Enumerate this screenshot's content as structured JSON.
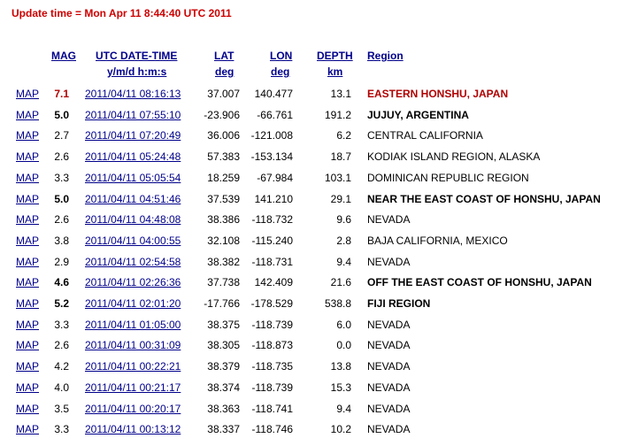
{
  "update_time": "Update time = Mon Apr 11 8:44:40 UTC 2011",
  "headers": {
    "mag": "MAG",
    "datetime": "UTC DATE-TIME",
    "datetime_sub": "y/m/d h:m:s",
    "lat": "LAT",
    "lat_sub": "deg",
    "lon": "LON",
    "lon_sub": "deg",
    "depth": "DEPTH",
    "depth_sub": "km",
    "region": "Region"
  },
  "rows": [
    {
      "map": "MAP",
      "mag": "7.1",
      "datetime": "2011/04/11 08:16:13",
      "lat": "37.007",
      "lon": "140.477",
      "depth": "13.1",
      "region": "EASTERN HONSHU, JAPAN",
      "style": "red"
    },
    {
      "map": "MAP",
      "mag": "5.0",
      "datetime": "2011/04/11 07:55:10",
      "lat": "-23.906",
      "lon": "-66.761",
      "depth": "191.2",
      "region": "JUJUY, ARGENTINA",
      "style": "big"
    },
    {
      "map": "MAP",
      "mag": "2.7",
      "datetime": "2011/04/11 07:20:49",
      "lat": "36.006",
      "lon": "-121.008",
      "depth": "6.2",
      "region": "CENTRAL CALIFORNIA",
      "style": "normal"
    },
    {
      "map": "MAP",
      "mag": "2.6",
      "datetime": "2011/04/11 05:24:48",
      "lat": "57.383",
      "lon": "-153.134",
      "depth": "18.7",
      "region": "KODIAK ISLAND REGION, ALASKA",
      "style": "normal"
    },
    {
      "map": "MAP",
      "mag": "3.3",
      "datetime": "2011/04/11 05:05:54",
      "lat": "18.259",
      "lon": "-67.984",
      "depth": "103.1",
      "region": "DOMINICAN REPUBLIC REGION",
      "style": "normal"
    },
    {
      "map": "MAP",
      "mag": "5.0",
      "datetime": "2011/04/11 04:51:46",
      "lat": "37.539",
      "lon": "141.210",
      "depth": "29.1",
      "region": "NEAR THE EAST COAST OF HONSHU, JAPAN",
      "style": "big"
    },
    {
      "map": "MAP",
      "mag": "2.6",
      "datetime": "2011/04/11 04:48:08",
      "lat": "38.386",
      "lon": "-118.732",
      "depth": "9.6",
      "region": "NEVADA",
      "style": "normal"
    },
    {
      "map": "MAP",
      "mag": "3.8",
      "datetime": "2011/04/11 04:00:55",
      "lat": "32.108",
      "lon": "-115.240",
      "depth": "2.8",
      "region": "BAJA CALIFORNIA, MEXICO",
      "style": "normal"
    },
    {
      "map": "MAP",
      "mag": "2.9",
      "datetime": "2011/04/11 02:54:58",
      "lat": "38.382",
      "lon": "-118.731",
      "depth": "9.4",
      "region": "NEVADA",
      "style": "normal"
    },
    {
      "map": "MAP",
      "mag": "4.6",
      "datetime": "2011/04/11 02:26:36",
      "lat": "37.738",
      "lon": "142.409",
      "depth": "21.6",
      "region": "OFF THE EAST COAST OF HONSHU, JAPAN",
      "style": "big"
    },
    {
      "map": "MAP",
      "mag": "5.2",
      "datetime": "2011/04/11 02:01:20",
      "lat": "-17.766",
      "lon": "-178.529",
      "depth": "538.8",
      "region": "FIJI REGION",
      "style": "big"
    },
    {
      "map": "MAP",
      "mag": "3.3",
      "datetime": "2011/04/11 01:05:00",
      "lat": "38.375",
      "lon": "-118.739",
      "depth": "6.0",
      "region": "NEVADA",
      "style": "normal"
    },
    {
      "map": "MAP",
      "mag": "2.6",
      "datetime": "2011/04/11 00:31:09",
      "lat": "38.305",
      "lon": "-118.873",
      "depth": "0.0",
      "region": "NEVADA",
      "style": "normal"
    },
    {
      "map": "MAP",
      "mag": "4.2",
      "datetime": "2011/04/11 00:22:21",
      "lat": "38.379",
      "lon": "-118.735",
      "depth": "13.8",
      "region": "NEVADA",
      "style": "normal"
    },
    {
      "map": "MAP",
      "mag": "4.0",
      "datetime": "2011/04/11 00:21:17",
      "lat": "38.374",
      "lon": "-118.739",
      "depth": "15.3",
      "region": "NEVADA",
      "style": "normal"
    },
    {
      "map": "MAP",
      "mag": "3.5",
      "datetime": "2011/04/11 00:20:17",
      "lat": "38.363",
      "lon": "-118.741",
      "depth": "9.4",
      "region": "NEVADA",
      "style": "normal"
    },
    {
      "map": "MAP",
      "mag": "3.3",
      "datetime": "2011/04/11 00:13:12",
      "lat": "38.337",
      "lon": "-118.746",
      "depth": "10.2",
      "region": "NEVADA",
      "style": "normal"
    }
  ]
}
